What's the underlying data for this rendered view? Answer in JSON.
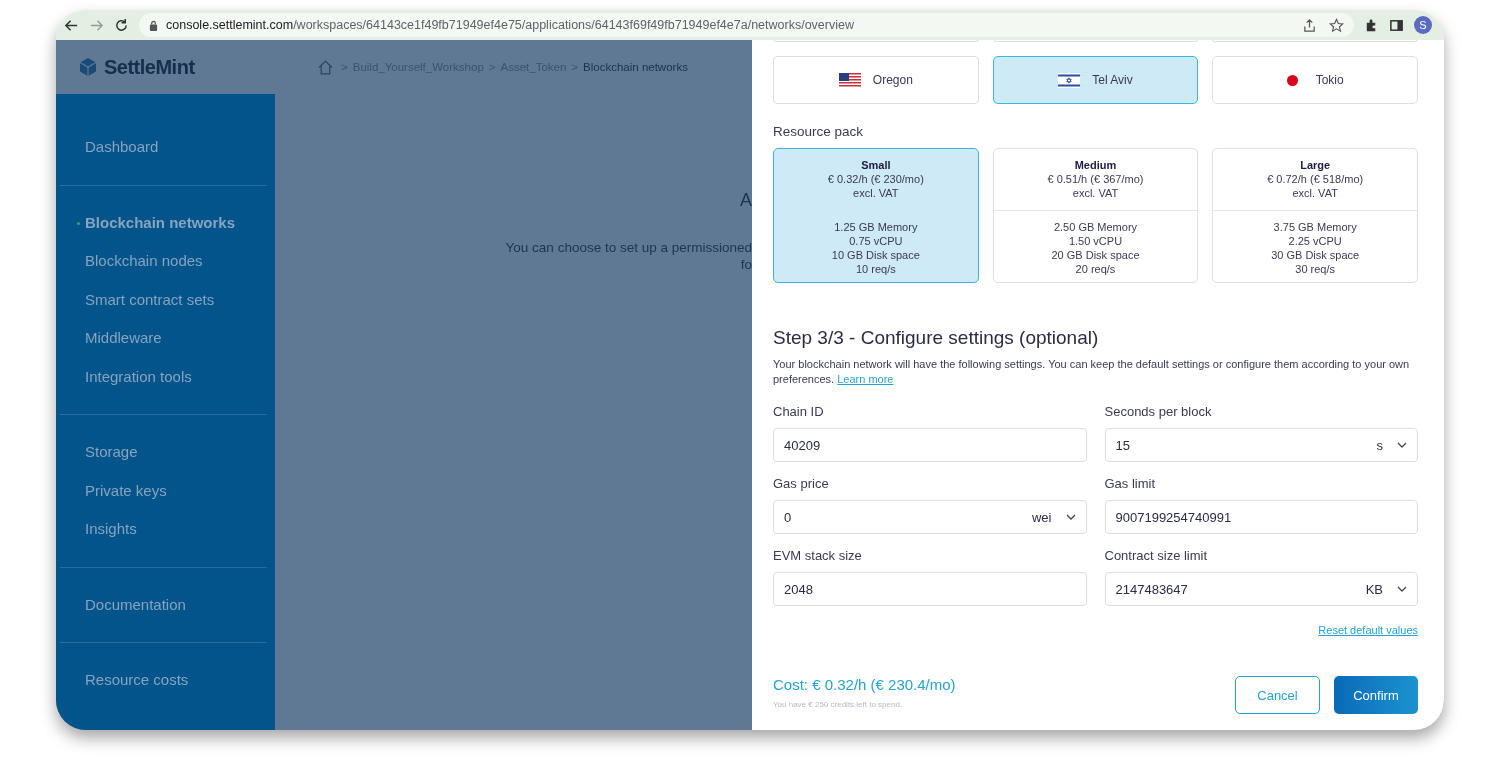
{
  "browser": {
    "url_host": "console.settlemint.com",
    "url_path": "/workspaces/64143ce1f49fb71949ef4e75/applications/64143f69f49fb71949ef4e7a/networks/overview",
    "avatar": "S"
  },
  "header": {
    "logo": "SettleMint",
    "breadcrumbs": [
      "Build_Yourself_Workshop",
      "Asset_Token",
      "Blockchain networks"
    ],
    "separator": ">"
  },
  "sidebar": {
    "groups": [
      {
        "items": [
          {
            "label": "Dashboard",
            "selected": false
          }
        ]
      },
      {
        "items": [
          {
            "label": "Blockchain networks",
            "selected": true
          },
          {
            "label": "Blockchain nodes",
            "selected": false
          },
          {
            "label": "Smart contract sets",
            "selected": false
          },
          {
            "label": "Middleware",
            "selected": false
          },
          {
            "label": "Integration tools",
            "selected": false
          }
        ]
      },
      {
        "items": [
          {
            "label": "Storage",
            "selected": false
          },
          {
            "label": "Private keys",
            "selected": false
          },
          {
            "label": "Insights",
            "selected": false
          }
        ]
      },
      {
        "items": [
          {
            "label": "Documentation",
            "selected": false
          }
        ]
      },
      {
        "items": [
          {
            "label": "Resource costs",
            "selected": false
          }
        ]
      }
    ]
  },
  "main": {
    "heading": "A",
    "text_lines": [
      "You can choose to set up a permissioned",
      "fo"
    ]
  },
  "drawer": {
    "locations": [
      {
        "label": "Oregon",
        "selected": false
      },
      {
        "label": "Tel Aviv",
        "selected": true
      },
      {
        "label": "Tokio",
        "selected": false
      }
    ],
    "resource_pack_label": "Resource pack",
    "packs": [
      {
        "name": "Small",
        "price": "€ 0.32/h (€ 230/mo)",
        "vat": "excl. VAT",
        "specs": [
          "1.25 GB Memory",
          "0.75 vCPU",
          "10 GB Disk space",
          "10 req/s"
        ],
        "selected": true
      },
      {
        "name": "Medium",
        "price": "€ 0.51/h (€ 367/mo)",
        "vat": "excl. VAT",
        "specs": [
          "2.50 GB Memory",
          "1.50 vCPU",
          "20 GB Disk space",
          "20 req/s"
        ],
        "selected": false
      },
      {
        "name": "Large",
        "price": "€ 0.72/h (€ 518/mo)",
        "vat": "excl. VAT",
        "specs": [
          "3.75 GB Memory",
          "2.25 vCPU",
          "30 GB Disk space",
          "30 req/s"
        ],
        "selected": false
      }
    ],
    "step_title": "Step 3/3 - Configure settings (optional)",
    "description": "Your blockchain network will have the following settings. You can keep the default settings or configure them according to your own preferences.",
    "learn_more": "Learn more",
    "fields": [
      {
        "label": "Chain ID",
        "value": "40209"
      },
      {
        "label": "Seconds per block",
        "value": "15",
        "unit": "s"
      },
      {
        "label": "Gas price",
        "value": "0",
        "unit": "wei"
      },
      {
        "label": "Gas limit",
        "value": "9007199254740991"
      },
      {
        "label": "EVM stack size",
        "value": "2048"
      },
      {
        "label": "Contract size limit",
        "value": "2147483647",
        "unit": "KB"
      }
    ],
    "reset_link": "Reset default values",
    "cost": "Cost: € 0.32/h (€ 230.4/mo)",
    "credits": "You have € 250 credits left to spend.",
    "buttons": [
      {
        "label": "Cancel",
        "kind": "secondary"
      },
      {
        "label": "Confirm",
        "kind": "primary"
      }
    ]
  }
}
